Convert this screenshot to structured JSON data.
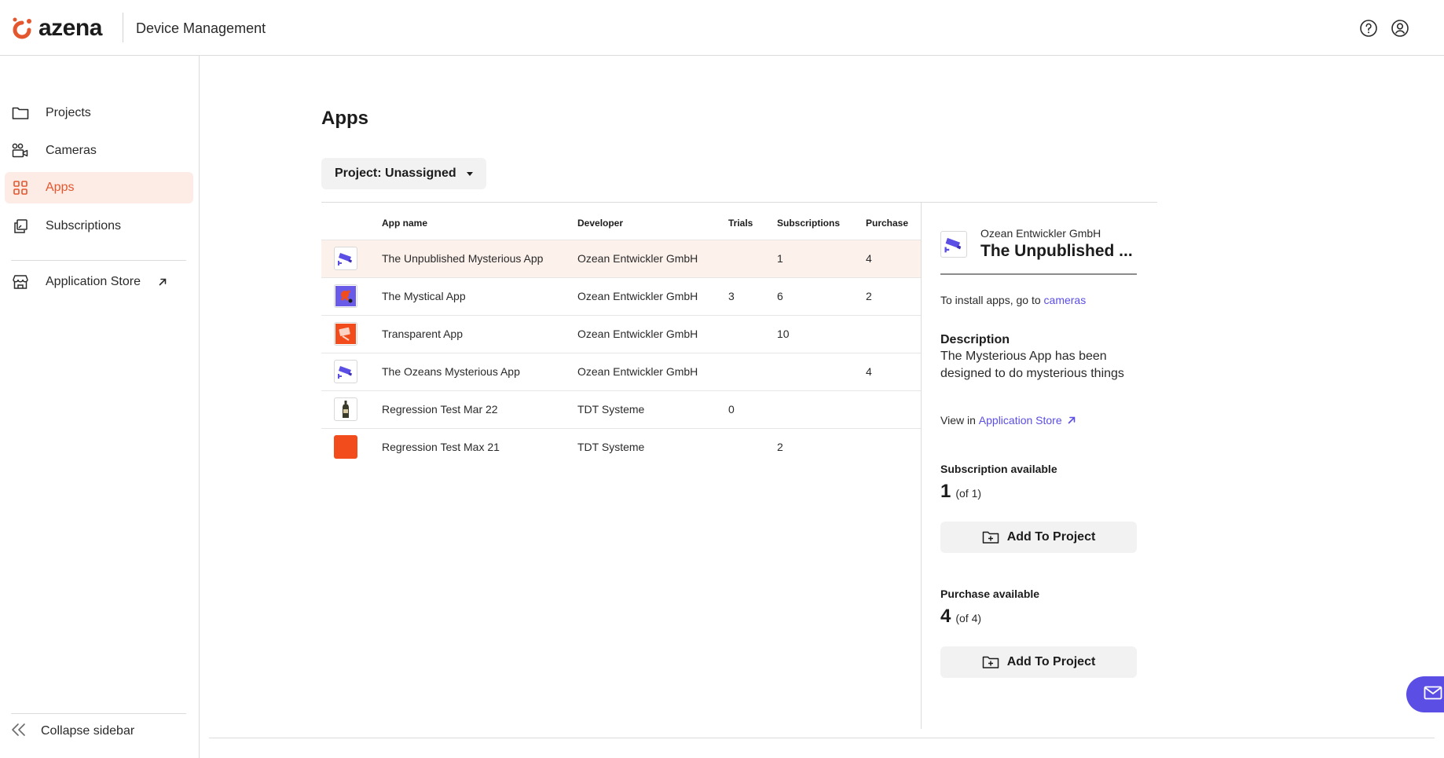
{
  "header": {
    "brand": "azena",
    "title": "Device Management"
  },
  "colors": {
    "accent": "#e4572e",
    "link": "#5b4ee4",
    "selected_row_bg": "#fdf1ec"
  },
  "sidebar": {
    "items": [
      {
        "label": "Projects",
        "icon": "folder-icon"
      },
      {
        "label": "Cameras",
        "icon": "camera-icon"
      },
      {
        "label": "Apps",
        "icon": "apps-grid-icon",
        "active": true
      },
      {
        "label": "Subscriptions",
        "icon": "subscriptions-icon"
      }
    ],
    "store": {
      "label": "Application Store",
      "icon": "store-icon"
    },
    "collapse_label": "Collapse sidebar"
  },
  "main": {
    "title": "Apps",
    "project_select": "Project: Unassigned"
  },
  "table": {
    "columns": [
      "App name",
      "Developer",
      "Trials",
      "Subscriptions",
      "Purchase"
    ],
    "rows": [
      {
        "name": "The Unpublished Mysterious App",
        "developer": "Ozean Entwickler GmbH",
        "trials": "",
        "subscriptions": "1",
        "purchase": "4",
        "icon": "camera-app-icon"
      },
      {
        "name": "The Mystical App",
        "developer": "Ozean Entwickler GmbH",
        "trials": "3",
        "subscriptions": "6",
        "purchase": "2",
        "icon": "mystical-app-icon"
      },
      {
        "name": "Transparent App",
        "developer": "Ozean Entwickler GmbH",
        "trials": "",
        "subscriptions": "10",
        "purchase": "",
        "icon": "transparent-app-icon"
      },
      {
        "name": "The Ozeans Mysterious App",
        "developer": "Ozean Entwickler GmbH",
        "trials": "",
        "subscriptions": "",
        "purchase": "4",
        "icon": "camera-app-icon"
      },
      {
        "name": "Regression Test Mar 22",
        "developer": "TDT Systeme",
        "trials": "0",
        "subscriptions": "",
        "purchase": "",
        "icon": "bottle-app-icon"
      },
      {
        "name": "Regression Test Max 21",
        "developer": "TDT Systeme",
        "trials": "",
        "subscriptions": "2",
        "purchase": "",
        "icon": "orange-square-icon"
      }
    ]
  },
  "detail": {
    "developer": "Ozean Entwickler GmbH",
    "name": "The Unpublished ...",
    "install_prefix": "To install apps, go to",
    "install_link": "cameras",
    "description_heading": "Description",
    "description": "The Mysterious App has been designed to do mysterious things",
    "view_prefix": "View in",
    "view_link": "Application Store",
    "subscription": {
      "heading": "Subscription available",
      "count": "1",
      "of": "(of 1)",
      "button": "Add To Project"
    },
    "purchase": {
      "heading": "Purchase available",
      "count": "4",
      "of": "(of 4)",
      "button": "Add To Project"
    }
  }
}
